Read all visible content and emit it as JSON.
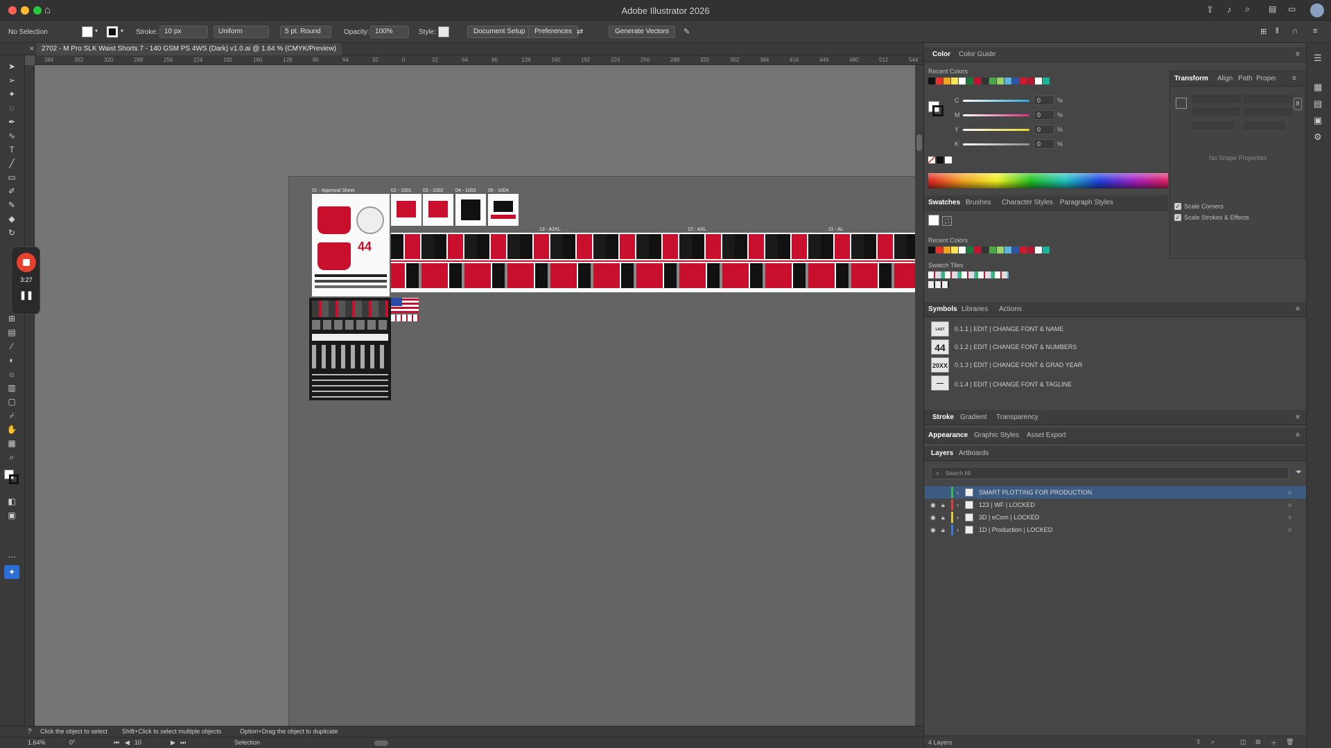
{
  "app": {
    "title": "Adobe Illustrator 2026",
    "document_tab": "2702 - M Pro SLK Waist Shorts 7 - 140 GSM PS 4WS (Dark) v1.0.ai @ 1.64 % (CMYK/Preview)"
  },
  "control_bar": {
    "selection": "No Selection",
    "stroke_label": "Stroke:",
    "stroke_value": "10 px",
    "profile": "Uniform",
    "brush": "5 pt. Round",
    "opacity_label": "Opacity:",
    "opacity_value": "100%",
    "style_label": "Style:",
    "document_setup": "Document Setup",
    "preferences": "Preferences",
    "generate_vectors": "Generate Vectors"
  },
  "rulers": {
    "h_ticks": [
      "384",
      "352",
      "320",
      "288",
      "256",
      "224",
      "192",
      "160",
      "128",
      "96",
      "64",
      "32",
      "0",
      "32",
      "64",
      "96",
      "128",
      "160",
      "192",
      "224",
      "256",
      "288",
      "320",
      "352",
      "384",
      "416",
      "448",
      "480",
      "512",
      "544"
    ]
  },
  "recording": {
    "time": "3:27"
  },
  "artboards": {
    "approval_label": "01 - Approval Sheet",
    "top_labels": [
      "02 - 1001",
      "03 - 1002",
      "04 - 1003",
      "05 - 1004"
    ],
    "size_labels": [
      "13 - A2XL",
      "12 - AXL",
      "11 - AL"
    ],
    "jersey_number": "44"
  },
  "status": {
    "hint1": "Click the object to select",
    "hint2": "Shift+Click to select multiple objects",
    "hint3": "Option+Drag the object to duplicate",
    "zoom": "1.64%",
    "rotation": "0°",
    "artboard_num": "10",
    "tool": "Selection"
  },
  "color_panel": {
    "tabs": [
      "Color",
      "Color Guide"
    ],
    "recent_label": "Recent Colors",
    "channels": [
      {
        "name": "C",
        "value": "0",
        "color": "#27a8d8"
      },
      {
        "name": "M",
        "value": "0",
        "color": "#d6307a"
      },
      {
        "name": "Y",
        "value": "0",
        "color": "#e8d730"
      },
      {
        "name": "K",
        "value": "0",
        "color": "#8a8a8a"
      }
    ],
    "percent": "%"
  },
  "swatches_panel": {
    "tabs": [
      "Swatches",
      "Brushes",
      "Character Styles",
      "Paragraph Styles"
    ],
    "recent_label": "Recent Colors",
    "tiles_label": "Swatch Tiles",
    "recent_colors": [
      "#111111",
      "#e5332a",
      "#f0a31c",
      "#f7e25a",
      "#ffffff",
      "#1b7a3a",
      "#c8102e",
      "#333333",
      "#4aa84a",
      "#9cd36a",
      "#5ab4e0",
      "#2a56a8",
      "#d21a2a",
      "#b01830",
      "#ffffff",
      "#1bb39a"
    ]
  },
  "transform_panel": {
    "tabs": [
      "Transform",
      "Align",
      "Path",
      "Properties"
    ],
    "no_shape": "No Shape Properties",
    "scale_corners": "Scale Corners",
    "scale_strokes": "Scale Strokes & Effects"
  },
  "symbols_panel": {
    "tabs": [
      "Symbols",
      "Libraries",
      "Actions"
    ],
    "items": [
      {
        "thumb": "LAST NAME",
        "label": "0.1.1 | EDIT | CHANGE FONT & NAME"
      },
      {
        "thumb": "44",
        "label": "0.1.2 | EDIT | CHANGE FONT & NUMBERS"
      },
      {
        "thumb": "20XX",
        "label": "0.1.3 | EDIT | CHANGE FONT & GRAD YEAR"
      },
      {
        "thumb": "—",
        "label": "0.1.4 | EDIT | CHANGE FONT & TAGLINE"
      }
    ]
  },
  "stroke_row": {
    "tabs": [
      "Stroke",
      "Gradient",
      "Transparency"
    ]
  },
  "appearance_row": {
    "tabs": [
      "Appearance",
      "Graphic Styles",
      "Asset Export"
    ]
  },
  "layers_panel": {
    "tabs": [
      "Layers",
      "Artboards"
    ],
    "search_placeholder": "Search All",
    "layers": [
      {
        "name": "SMART PLOTTING FOR PRODUCTION",
        "color": "#3ac04a",
        "selected": true
      },
      {
        "name": "123 | WF | LOCKED",
        "color": "#e23a3a",
        "selected": false
      },
      {
        "name": "3D | eCom | LOCKED",
        "color": "#e0d030",
        "selected": false
      },
      {
        "name": "1D | Production | LOCKED",
        "color": "#3a7ae0",
        "selected": false
      }
    ],
    "count": "4 Layers"
  }
}
